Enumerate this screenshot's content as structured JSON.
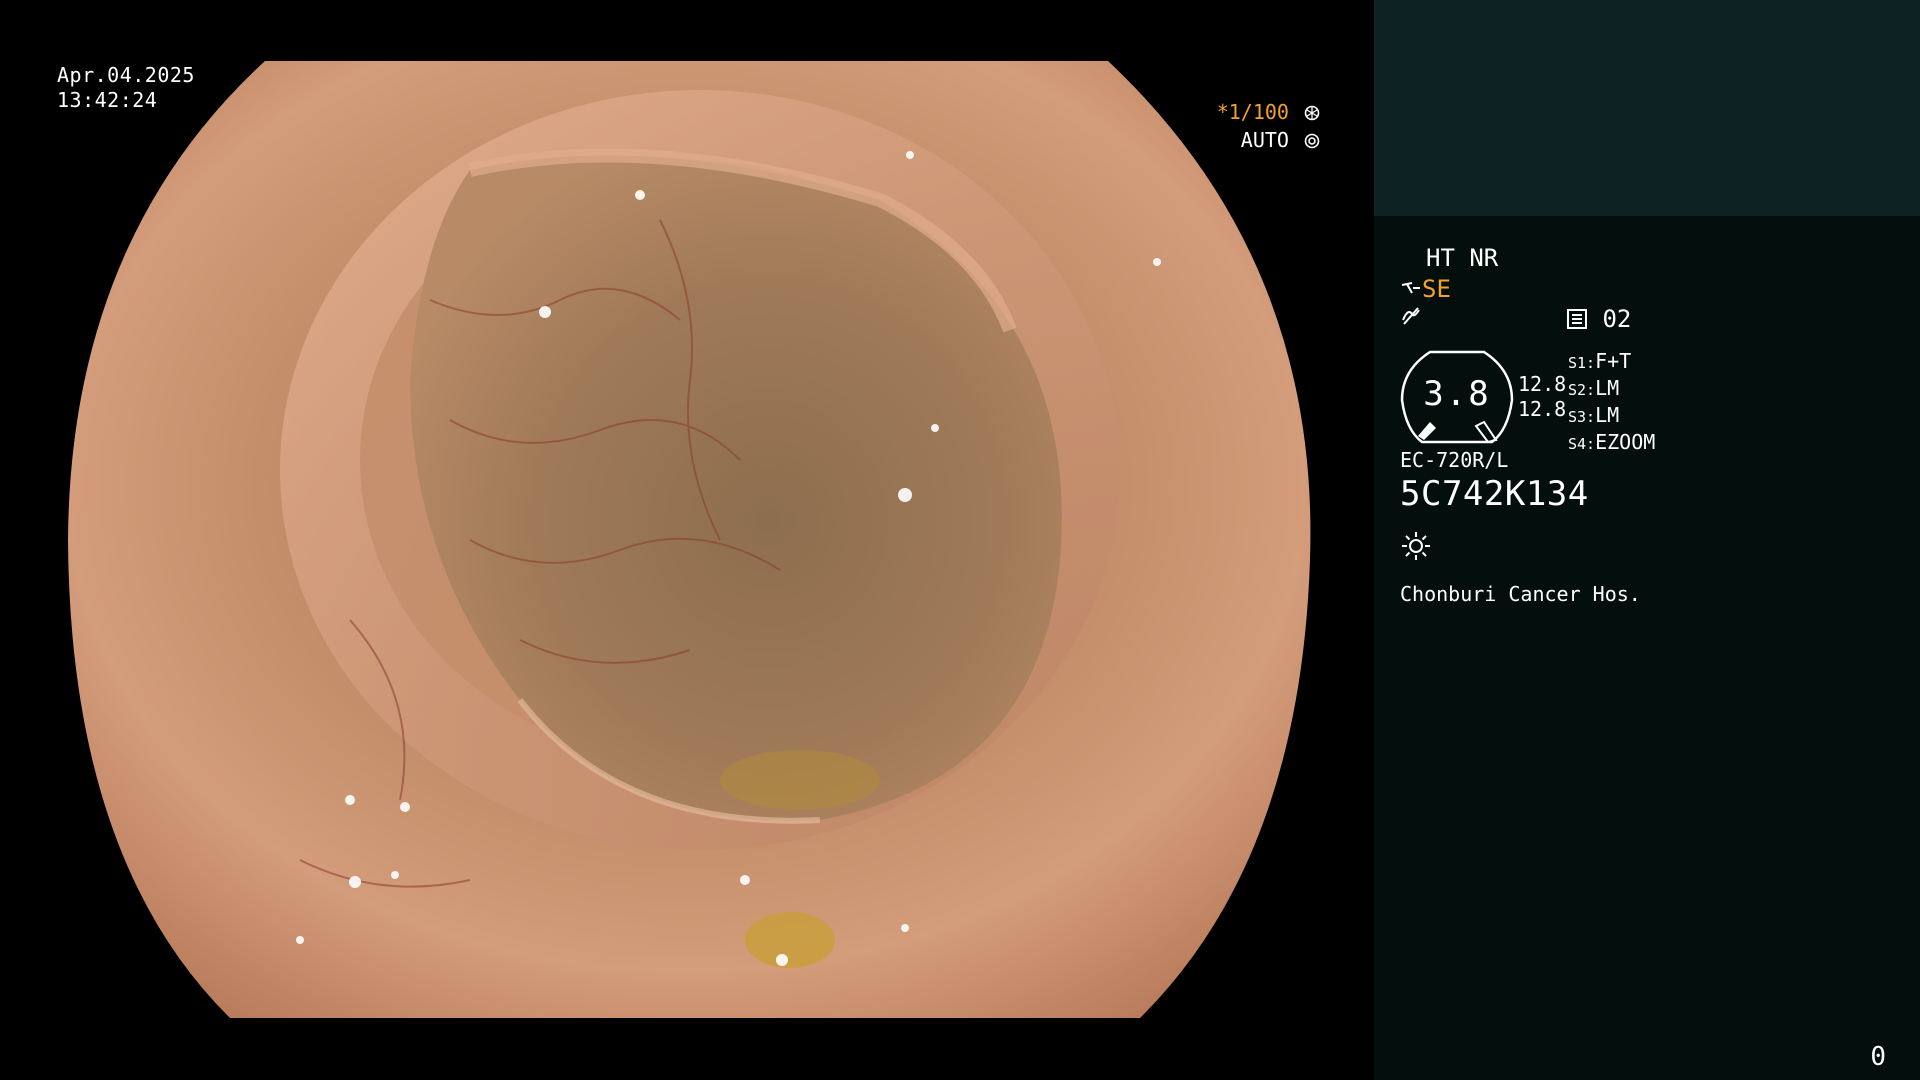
{
  "overlay": {
    "date": "Apr.04.2025",
    "time": "13:42:24",
    "shutter_speed": "*1/100",
    "iris_mode": "AUTO"
  },
  "panel": {
    "processing": "HT NR",
    "structure_enhancement": "SE",
    "channel": "02",
    "gauge_value": "3.8",
    "gauge_side_values": [
      "12.8",
      "12.8"
    ],
    "settings": [
      {
        "key": "S1:",
        "value": "F+T"
      },
      {
        "key": "S2:",
        "value": "LM"
      },
      {
        "key": "S3:",
        "value": "LM"
      },
      {
        "key": "S4:",
        "value": "EZOOM"
      }
    ],
    "scope_model": "EC-720R/L",
    "serial_number": "5C742K134",
    "hospital": "Chonburi Cancer Hos.",
    "counter": "0"
  },
  "icons": {
    "shutter": "aperture-icon",
    "iris": "iris-icon",
    "se_prefix": "angle-icon",
    "ce_prefix": "contrast-icon",
    "channel": "memory-card-icon",
    "light": "light-source-icon"
  },
  "colors": {
    "panel_top": "#0d2222",
    "panel_bottom": "#040e0d",
    "accent_orange": "#f2a22c",
    "text_white": "#ffffff"
  }
}
